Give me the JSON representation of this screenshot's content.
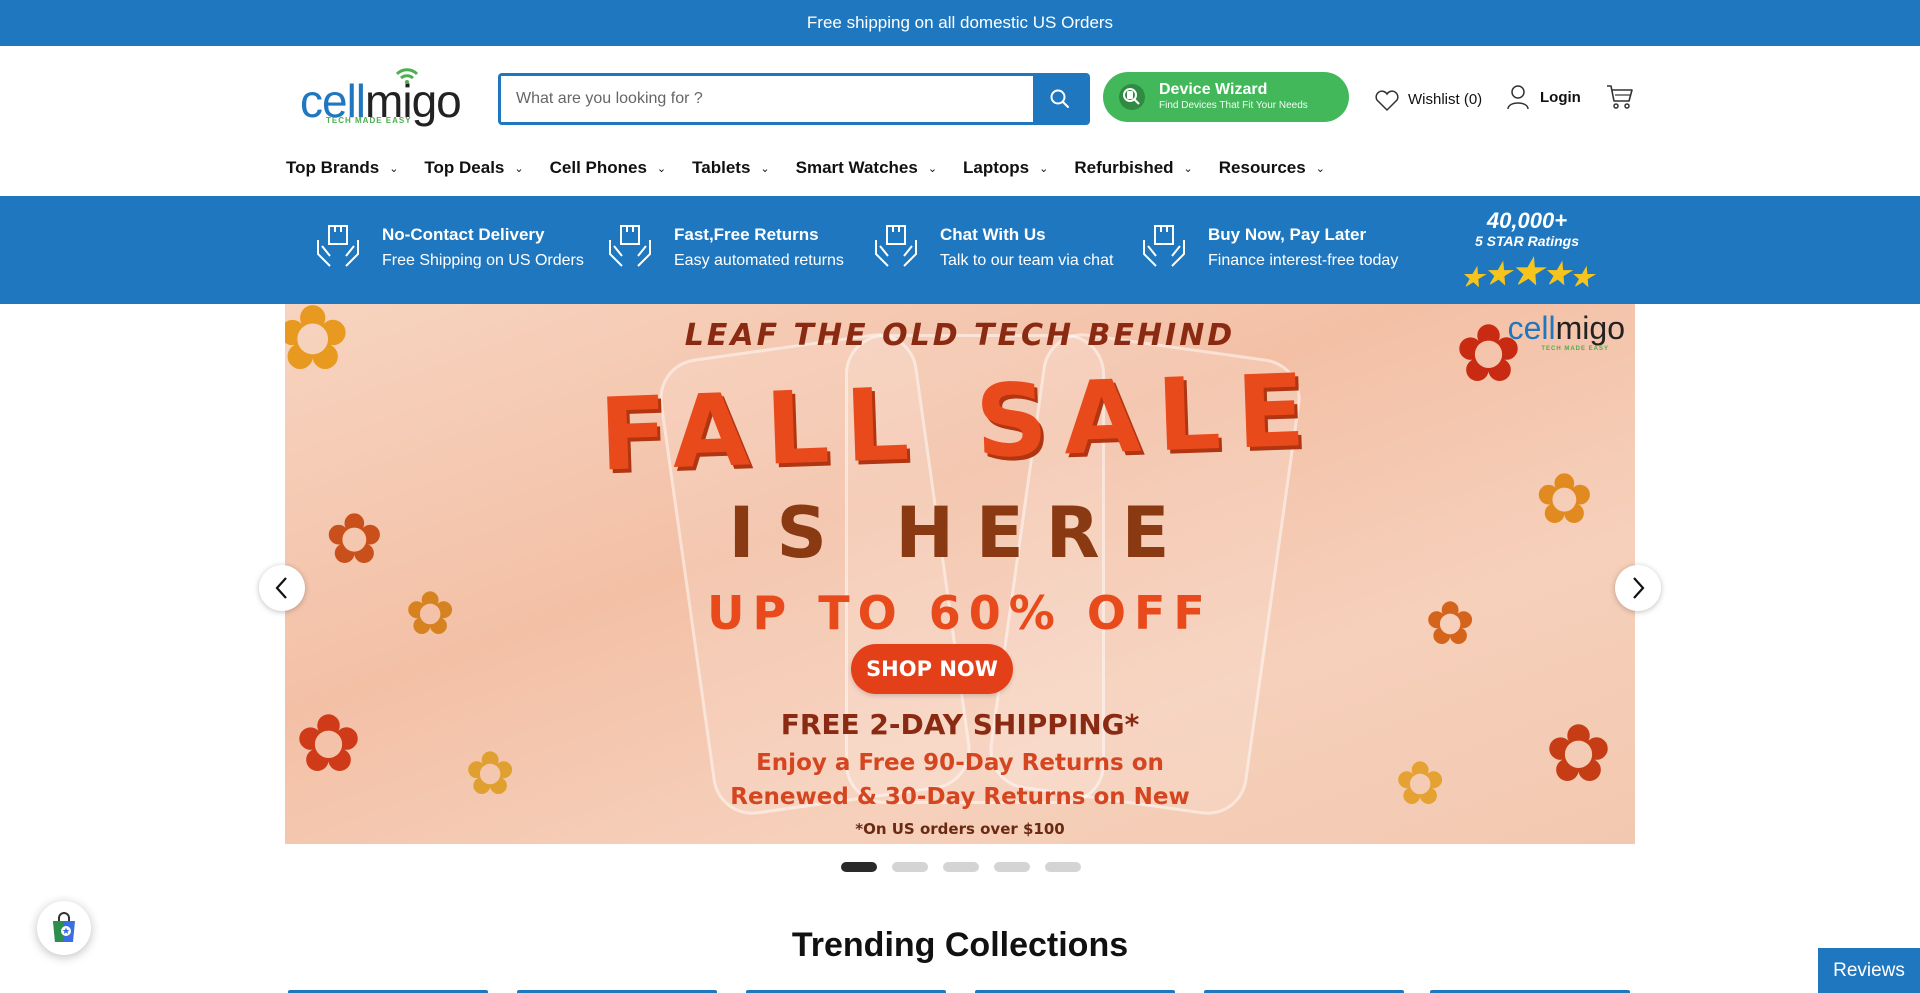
{
  "announcement": {
    "text": "Free shipping on all domestic US Orders"
  },
  "logo": {
    "part1": "cell",
    "part2": "migo",
    "tagline": "TECH MADE EASY"
  },
  "search": {
    "placeholder": "What are you looking for ?",
    "value": "",
    "icon": "search-icon"
  },
  "device_wizard": {
    "title": "Device Wizard",
    "subtitle": "Find Devices That Fit Your Needs",
    "icon": "wizard-icon"
  },
  "header_actions": {
    "wishlist": {
      "label": "Wishlist (0)",
      "icon": "heart-icon"
    },
    "login": {
      "label": "Login",
      "icon": "user-icon"
    },
    "cart": {
      "icon": "cart-icon"
    }
  },
  "nav": {
    "items": [
      {
        "label": "Top Brands"
      },
      {
        "label": "Top Deals"
      },
      {
        "label": "Cell Phones"
      },
      {
        "label": "Tablets"
      },
      {
        "label": "Smart Watches"
      },
      {
        "label": "Laptops"
      },
      {
        "label": "Refurbished"
      },
      {
        "label": "Resources"
      }
    ],
    "chevron": "⌄"
  },
  "features": {
    "items": [
      {
        "title": "No-Contact Delivery",
        "subtitle": "Free Shipping on US Orders"
      },
      {
        "title": "Fast,Free Returns",
        "subtitle": "Easy automated returns"
      },
      {
        "title": "Chat With Us",
        "subtitle": "Talk to our team via chat"
      },
      {
        "title": "Buy Now, Pay Later",
        "subtitle": "Finance interest-free today"
      }
    ],
    "ratings": {
      "count": "40,000+",
      "label": "5 STAR Ratings",
      "stars": 5
    }
  },
  "banner": {
    "headline_top": "LEAF THE OLD TECH BEHIND",
    "headline_main": "FALL SALE",
    "headline_sub": "IS HERE",
    "discount": "UP TO 60% OFF",
    "cta": "SHOP NOW",
    "shipping": "FREE 2-DAY SHIPPING*",
    "returns_line1": "Enjoy a Free 90-Day Returns on",
    "returns_line2": "Renewed & 30-Day Returns on New",
    "footnote": "*On US orders over $100",
    "logo_part1": "cell",
    "logo_part2": "migo",
    "logo_tagline": "TECH MADE EASY"
  },
  "carousel": {
    "slides": 5,
    "active_index": 0
  },
  "trending": {
    "title": "Trending Collections"
  },
  "reviews_tab": {
    "label": "Reviews"
  },
  "colors": {
    "primary": "#1f78bf",
    "accent_green": "#42b85a",
    "sale_orange": "#e84a1c"
  }
}
